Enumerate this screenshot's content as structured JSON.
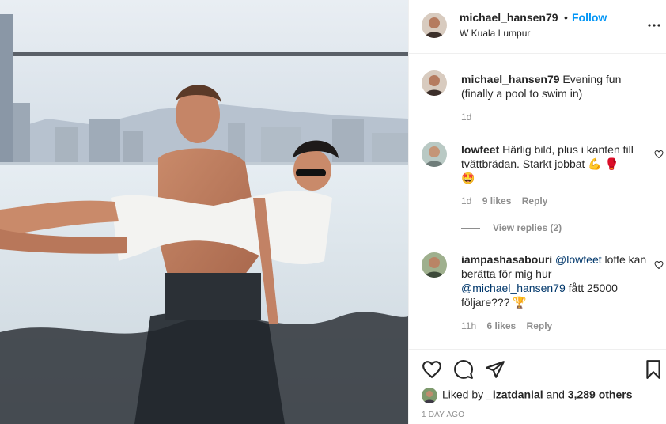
{
  "post": {
    "author": "michael_hansen79",
    "separator": "•",
    "follow_label": "Follow",
    "location": "W Kuala Lumpur"
  },
  "icons": {
    "more": "more-options-icon",
    "like": "heart-icon",
    "comment": "comment-icon",
    "share": "paper-plane-icon",
    "save": "bookmark-icon"
  },
  "caption": {
    "user": "michael_hansen79",
    "text": "Evening fun (finally a pool to swim in)",
    "time": "1d"
  },
  "comments": [
    {
      "user": "lowfeet",
      "text": "Härlig bild, plus i kanten till tvättbrädan. Starkt jobbat 💪 🥊",
      "text_line2": "🤩",
      "time": "1d",
      "likes": "9 likes",
      "reply": "Reply",
      "view_replies": "View replies (2)"
    },
    {
      "user": "iampashasabouri",
      "mention1": "@lowfeet",
      "text1": "loffe kan berätta för mig hur",
      "mention2": "@michael_hansen79",
      "text2": "fått 25000 följare??? 🏆",
      "time": "11h",
      "likes": "6 likes",
      "reply": "Reply"
    }
  ],
  "likes": {
    "prefix": "Liked by",
    "user": "_izatdanial",
    "and": "and",
    "others": "3,289 others"
  },
  "date": "1 DAY AGO",
  "colors": {
    "link": "#0095f6",
    "text": "#262626",
    "muted": "#8e8e8e",
    "border": "#efefef"
  }
}
